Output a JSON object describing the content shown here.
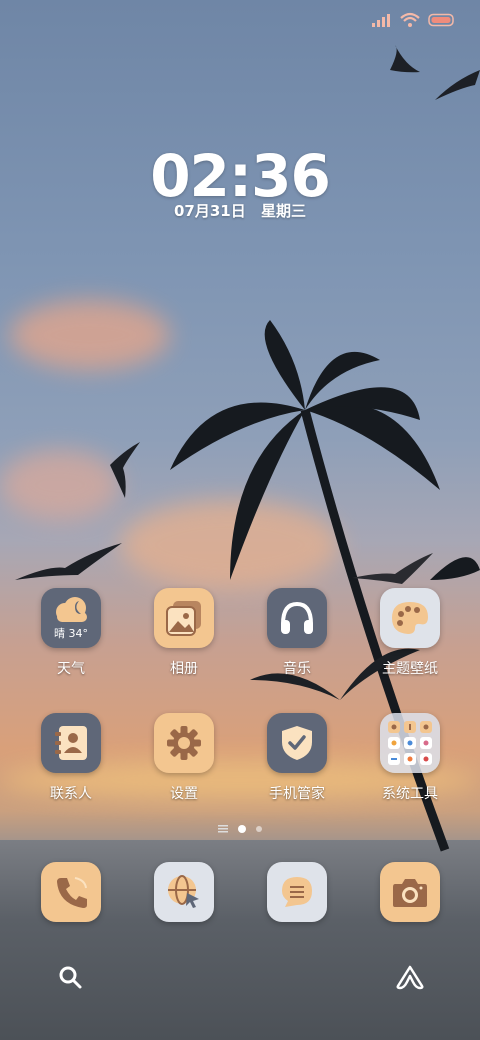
{
  "clock": {
    "time": "02:36",
    "date": "07月31日",
    "weekday": "星期三"
  },
  "apps_row1": [
    {
      "name": "天气",
      "weather_text": "晴 34°"
    },
    {
      "name": "相册"
    },
    {
      "name": "音乐"
    },
    {
      "name": "主题壁纸"
    }
  ],
  "apps_row2": [
    {
      "name": "联系人"
    },
    {
      "name": "设置"
    },
    {
      "name": "手机管家"
    },
    {
      "name": "系统工具"
    }
  ],
  "dock": [
    "phone-icon",
    "browser-icon",
    "messages-icon",
    "camera-icon"
  ],
  "pager": {
    "pages": 2,
    "current": 1
  },
  "colors": {
    "icon_slate": "#5f6778",
    "icon_peach": "#f3c690",
    "icon_light": "#dfe3ea",
    "accent_brown": "#9a6848"
  }
}
